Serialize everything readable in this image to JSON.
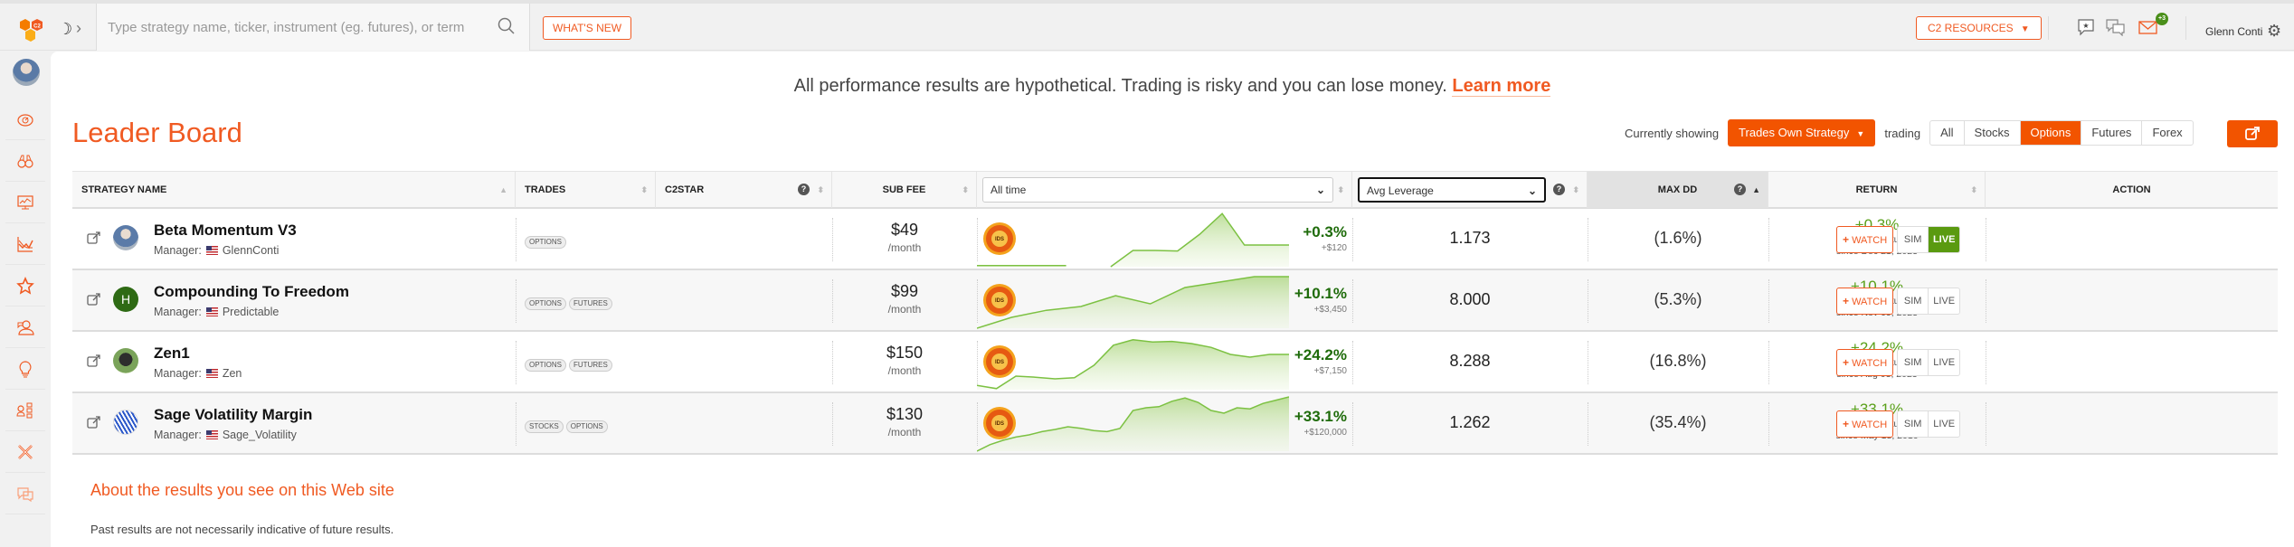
{
  "header": {
    "search_placeholder": "Type strategy name, ticker, instrument (eg. futures), or term",
    "whats_new": "WHAT'S NEW",
    "c2_resources": "C2 RESOURCES",
    "mail_badge": "+3",
    "user_name": "Glenn Conti",
    "accent_color": "#f25400"
  },
  "sidebar": {
    "items": [
      {
        "icon": "dashboard-gauge-icon"
      },
      {
        "icon": "binoculars-icon"
      },
      {
        "icon": "monitor-chart-icon"
      },
      {
        "icon": "line-chart-icon"
      },
      {
        "icon": "star-icon"
      },
      {
        "icon": "community-icon"
      },
      {
        "icon": "lightbulb-icon"
      },
      {
        "icon": "org-chart-icon"
      },
      {
        "icon": "tools-icon"
      },
      {
        "icon": "chat-icon"
      }
    ]
  },
  "disclaimer": {
    "text": "All performance results are hypothetical. Trading is risky and you can lose money.",
    "link": "Learn more"
  },
  "page_title": "Leader Board",
  "filters": {
    "currently_showing_label": "Currently showing",
    "selected_filter": "Trades Own Strategy",
    "trading_label": "trading",
    "asset_tabs": [
      {
        "label": "All",
        "active": false
      },
      {
        "label": "Stocks",
        "active": false
      },
      {
        "label": "Options",
        "active": true
      },
      {
        "label": "Futures",
        "active": false
      },
      {
        "label": "Forex",
        "active": false
      }
    ]
  },
  "table": {
    "columns": {
      "strategy_name": "STRATEGY NAME",
      "trades": "TRADES",
      "c2star": "C2STAR",
      "sub_fee": "SUB FEE",
      "period_select": "All time",
      "metric_select": "Avg Leverage",
      "max_dd": "MAX DD",
      "return": "RETURN",
      "action": "ACTION"
    },
    "rows": [
      {
        "name": "Beta Momentum V3",
        "manager_label": "Manager:",
        "manager": "GlennConti",
        "tags": [
          "OPTIONS"
        ],
        "fee": "$49",
        "fee_period": "/month",
        "period_return": "+0.3%",
        "period_usd": "+$120",
        "metric": "1.173",
        "max_dd": "(1.6%)",
        "return": "+0.3%",
        "return_type": "Cumul. Return",
        "since": "since Dec 21, 2023",
        "watch": "WATCH",
        "sim": "SIM",
        "live": "LIVE",
        "live_active": true,
        "spark": [
          0.02,
          0.02,
          0.02,
          0.02,
          0.02,
          null,
          0.0,
          0.3,
          0.3,
          0.29,
          0.6,
          0.98,
          0.4,
          0.4,
          0.4
        ]
      },
      {
        "name": "Compounding To Freedom",
        "manager_label": "Manager:",
        "manager": "Predictable",
        "tags": [
          "OPTIONS",
          "FUTURES"
        ],
        "fee": "$99",
        "fee_period": "/month",
        "period_return": "+10.1%",
        "period_usd": "+$3,450",
        "metric": "8.000",
        "max_dd": "(5.3%)",
        "return": "+10.1%",
        "return_type": "Cumul. Return",
        "since": "since Nov 09, 2023",
        "watch": "WATCH",
        "sim": "SIM",
        "live": "LIVE",
        "live_active": false,
        "spark": [
          0.0,
          0.2,
          0.33,
          0.4,
          0.6,
          0.45,
          0.75,
          0.85,
          0.95,
          0.95
        ]
      },
      {
        "name": "Zen1",
        "manager_label": "Manager:",
        "manager": "Zen",
        "tags": [
          "OPTIONS",
          "FUTURES"
        ],
        "fee": "$150",
        "fee_period": "/month",
        "period_return": "+24.2%",
        "period_usd": "+$7,150",
        "metric": "8.288",
        "max_dd": "(16.8%)",
        "return": "+24.2%",
        "return_type": "Cumul. Return",
        "since": "since Aug 03, 2023",
        "watch": "WATCH",
        "sim": "SIM",
        "live": "LIVE",
        "live_active": false,
        "spark": [
          0.08,
          0.02,
          0.25,
          0.23,
          0.2,
          0.22,
          0.45,
          0.82,
          0.92,
          0.88,
          0.89,
          0.85,
          0.78,
          0.65,
          0.6,
          0.65,
          0.65
        ]
      },
      {
        "name": "Sage Volatility Margin",
        "manager_label": "Manager:",
        "manager": "Sage_Volatility",
        "tags": [
          "STOCKS",
          "OPTIONS"
        ],
        "fee": "$130",
        "fee_period": "/month",
        "period_return": "+33.1%",
        "period_usd": "+$120,000",
        "metric": "1.262",
        "max_dd": "(35.4%)",
        "return": "+33.1%",
        "return_type": "Annual Return",
        "since": "since May 18, 2016",
        "watch": "WATCH",
        "sim": "SIM",
        "live": "LIVE",
        "live_active": false,
        "spark": [
          0.0,
          0.12,
          0.2,
          0.26,
          0.3,
          0.36,
          0.4,
          0.45,
          0.42,
          0.38,
          0.36,
          0.42,
          0.75,
          0.8,
          0.82,
          0.92,
          0.98,
          0.9,
          0.75,
          0.7,
          0.8,
          0.78,
          0.88,
          0.94,
          1.0
        ]
      }
    ]
  },
  "about": {
    "title": "About the results you see on this Web site",
    "text": "Past results are not necessarily indicative of future results."
  }
}
